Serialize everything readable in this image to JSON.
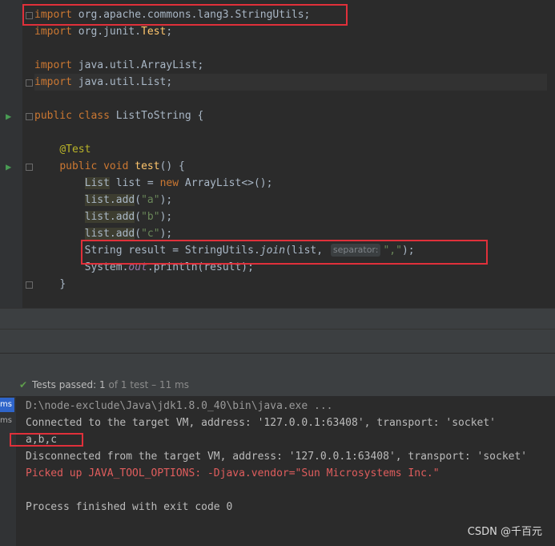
{
  "editor": {
    "line_import_stringutils": {
      "kw": "import",
      "rest": " org.apache.commons.lang3.StringUtils;"
    },
    "line_import_test": {
      "kw": "import",
      "pkg": " org.junit.",
      "cls": "Test",
      "semi": ";"
    },
    "line_import_arraylist": {
      "kw": "import",
      "rest": " java.util.ArrayList;"
    },
    "line_import_list": {
      "kw": "import",
      "rest": " java.util.List;"
    },
    "line_class": {
      "kw1": "public",
      "kw2": " class",
      "rest": " ListToString {"
    },
    "line_annotation": "@Test",
    "line_method": {
      "kw1": "public",
      "kw2": " void",
      "name": " test",
      "rest": "() {"
    },
    "line_list_decl": {
      "type": "List",
      "rest1": " list = ",
      "kw": "new",
      "rest2": " ArrayList<>();"
    },
    "line_add_a": {
      "call": "list.add",
      "open": "(",
      "arg": "\"a\"",
      "close": ");"
    },
    "line_add_b": {
      "call": "list.add",
      "open": "(",
      "arg": "\"b\"",
      "close": ");"
    },
    "line_add_c": {
      "call": "list.add",
      "open": "(",
      "arg": "\"c\"",
      "close": ");"
    },
    "line_join": {
      "pre": "String result = StringUtils.",
      "method": "join",
      "args": "(list, ",
      "hint": "separator:",
      "arg": "\",\"",
      "close": ");"
    },
    "line_println": {
      "pre": "System.",
      "field": "out",
      "rest": ".println(result);"
    },
    "line_close_method": "}"
  },
  "test_status": {
    "passed_label": "Tests passed: ",
    "passed_count": "1",
    "of_total": " of 1 test – 11 ms"
  },
  "side_times": [
    "ms",
    "ms"
  ],
  "console": {
    "lines": [
      "D:\\node-exclude\\Java\\jdk1.8.0_40\\bin\\java.exe ...",
      "Connected to the target VM, address: '127.0.0.1:63408', transport: 'socket'",
      "a,b,c",
      "Disconnected from the target VM, address: '127.0.0.1:63408', transport: 'socket'",
      "Picked up JAVA_TOOL_OPTIONS: -Djava.vendor=\"Sun Microsystems Inc.\"",
      "Process finished with exit code 0"
    ]
  },
  "watermark": "CSDN @千百元",
  "colors": {
    "highlight_box": "#e0303a",
    "pass_check": "#5f9e4c",
    "error_text": "#e05d5d"
  },
  "icons": [
    "run-test-icon",
    "fold-icon",
    "check-icon"
  ]
}
